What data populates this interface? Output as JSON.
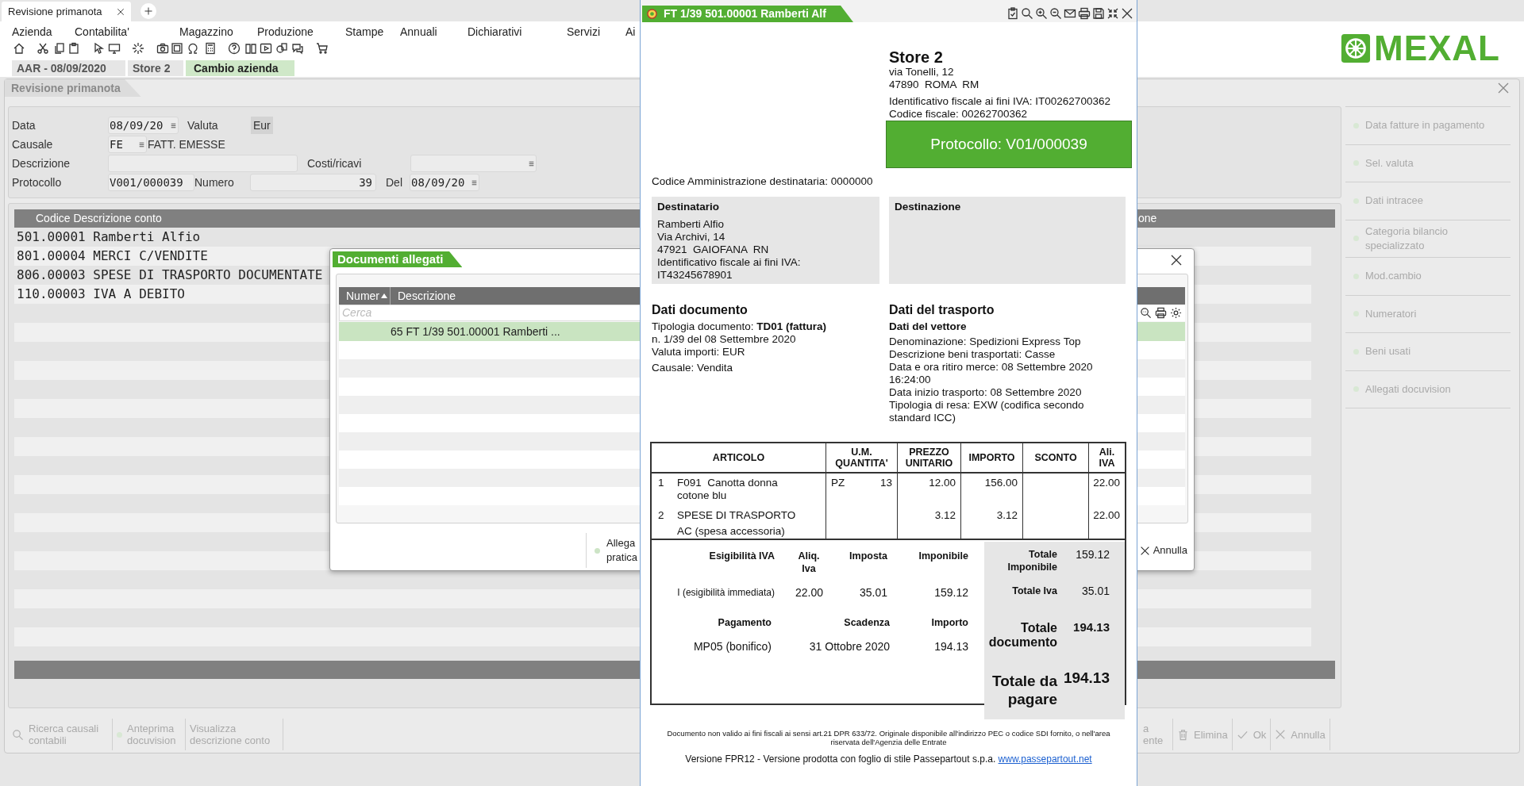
{
  "tabs": [
    {
      "label": "Revisione primanota",
      "selected": true
    }
  ],
  "menu": [
    "Azienda",
    "Contabilita'",
    "Magazzino",
    "Produzione",
    "Stampe",
    "Annuali",
    "Dichiarativi",
    "Servizi",
    "Ai"
  ],
  "company_bar": {
    "company": "AAR - 08/09/2020",
    "store": "Store 2",
    "action": "Cambio azienda"
  },
  "logo": "MEXAL",
  "window": {
    "title": "Revisione primanota"
  },
  "form": {
    "data": {
      "label": "Data",
      "value": "08/09/20"
    },
    "valuta": {
      "label": "Valuta",
      "value": "Eur"
    },
    "causale": {
      "label": "Causale",
      "value": "FE",
      "description": "FATT. EMESSE"
    },
    "descrizione": {
      "label": "Descrizione"
    },
    "costi_ricavi": {
      "label": "Costi/ricavi"
    },
    "protocollo": {
      "label": "Protocollo",
      "value": "V001/000039"
    },
    "numero": {
      "label": "Numero",
      "value": "39"
    },
    "del": {
      "label": "Del",
      "value": "08/09/20"
    }
  },
  "accounts": {
    "columns": [
      "Codice Descrizione conto",
      "one"
    ],
    "rows": [
      "501.00001 Ramberti Alfio",
      "801.00004 MERCI C/VENDITE",
      "806.00003 SPESE DI TRASPORTO DOCUMENTATE",
      "110.00003 IVA A DEBITO"
    ]
  },
  "side_actions": [
    {
      "label": "Data fatture in pagamento",
      "disabled": true
    },
    {
      "label": "Sel. valuta",
      "disabled": true
    },
    {
      "label": "Dati intracee",
      "disabled": true
    },
    {
      "label": "Categoria bilancio specializzato",
      "disabled": true
    },
    {
      "label": "Mod.cambio",
      "disabled": true
    },
    {
      "label": "Numeratori",
      "disabled": true
    },
    {
      "label": "Beni usati",
      "disabled": true
    },
    {
      "label": "Allegati docuvision",
      "disabled": true
    }
  ],
  "bottom_buttons": [
    {
      "label": "Ricerca causali contabili",
      "kind": "search",
      "disabled": true
    },
    {
      "label": "Anteprima docuvision",
      "kind": "dot",
      "disabled": true
    },
    {
      "label": "Visualizza descrizione conto",
      "kind": "plain",
      "disabled": true
    }
  ],
  "bottom_buttons_right": [
    {
      "label": "a ente",
      "kind": "plain",
      "disabled": true
    },
    {
      "label": "Elimina",
      "kind": "trash",
      "disabled": true
    },
    {
      "label": "Ok",
      "kind": "check",
      "disabled": true
    },
    {
      "label": "Annulla",
      "kind": "cross",
      "disabled": true
    }
  ],
  "attachments_dialog": {
    "title": "Documenti allegati",
    "columns": [
      {
        "label": "Numer",
        "sorted_ascending": true
      },
      {
        "label": "Descrizione",
        "sorted_ascending": false
      }
    ],
    "search": {
      "placeholder": "Cerca"
    },
    "rows": [
      {
        "text": "65 FT 1/39 501.00001 Ramberti ...",
        "selected": true
      }
    ],
    "actions": [
      {
        "label": "Allega pratica",
        "kind": "dot"
      },
      {
        "label": "Annulla",
        "kind": "cancel"
      }
    ]
  },
  "invoice": {
    "title": "FT 1/39 501.00001 Ramberti Alf",
    "issuer": {
      "name": "Store 2",
      "address": [
        "via Tonelli, 12",
        "47890  ROMA  RM"
      ],
      "ids": [
        "Identificativo fiscale ai fini IVA: IT00262700362",
        "Codice fiscale: 00262700362"
      ]
    },
    "protocol": "Protocollo: V01/000039",
    "recipient_code": "Codice Amministrazione destinataria: 0000000",
    "recipient": {
      "heading": "Destinatario",
      "lines": [
        "Ramberti Alfio",
        "Via Archivi, 14",
        "47921  GAIOFANA  RN",
        "Identificativo fiscale ai fini IVA:",
        "IT43245678901"
      ]
    },
    "destination": {
      "heading": "Destinazione"
    },
    "document": {
      "heading": "Dati documento",
      "lines": [
        "Tipologia documento: **TD01 (fattura)**",
        "n. 1/39 del 08 Settembre 2020",
        "Valuta importi: EUR"
      ],
      "causale": "Causale: Vendita"
    },
    "transport": {
      "heading": "Dati del trasporto",
      "subheading": "Dati del vettore",
      "lines": [
        "Denominazione: Spedizioni Express Top",
        "Descrizione beni trasportati: Casse",
        "Data e ora ritiro merce: 08 Settembre 2020 16:24:00",
        "Data inizio trasporto: 08 Settembre 2020",
        "Tipologia di resa: EXW (codifica secondo standard ICC)"
      ]
    },
    "columns": [
      "ARTICOLO",
      "U.M. QUANTITA'",
      "PREZZO UNITARIO",
      "IMPORTO",
      "SCONTO",
      "Ali. IVA"
    ],
    "items": [
      {
        "n": "1",
        "code": "F091",
        "description": "Canotta donna cotone blu",
        "um": "PZ",
        "qty": "13",
        "price": "12.00",
        "amount": "156.00",
        "vat": "22.00"
      },
      {
        "n": "2",
        "description": "SPESE DI TRASPORTO",
        "note": "AC (spesa accessoria)",
        "price": "3.12",
        "amount": "3.12",
        "vat": "22.00"
      }
    ],
    "vat_columns": [
      "Esigibilità IVA",
      "Aliq. Iva",
      "Imposta",
      "Imponibile"
    ],
    "vat_rows": [
      {
        "esigibilita": "I (esigibilità immediata)",
        "aliquota": "22.00",
        "imposta": "35.01",
        "imponibile": "159.12"
      }
    ],
    "payment_columns": [
      "Pagamento",
      "Scadenza",
      "Importo"
    ],
    "payments": [
      {
        "method": "MP05 (bonifico)",
        "due": "31 Ottobre 2020",
        "amount": "194.13"
      }
    ],
    "totals": [
      {
        "label": "Totale Imponibile",
        "value": "159.12",
        "kind": "normal"
      },
      {
        "label": "Totale Iva",
        "value": "35.01",
        "kind": "normal"
      },
      {
        "label": "Totale documento",
        "value": "194.13",
        "kind": "strong"
      },
      {
        "label": "Totale da pagare",
        "value": "194.13",
        "kind": "large"
      }
    ],
    "disclaimer": "Documento non valido ai fini fiscali ai sensi art.21 DPR 633/72. Originale disponibile all'indirizzo PEC o codice SDI fornito, o nell'area riservata dell'Agenzia delle Entrate",
    "version": "Versione FPR12 - Versione prodotta con foglio di stile Passepartout s.p.a.",
    "link": "www.passepartout.net"
  }
}
